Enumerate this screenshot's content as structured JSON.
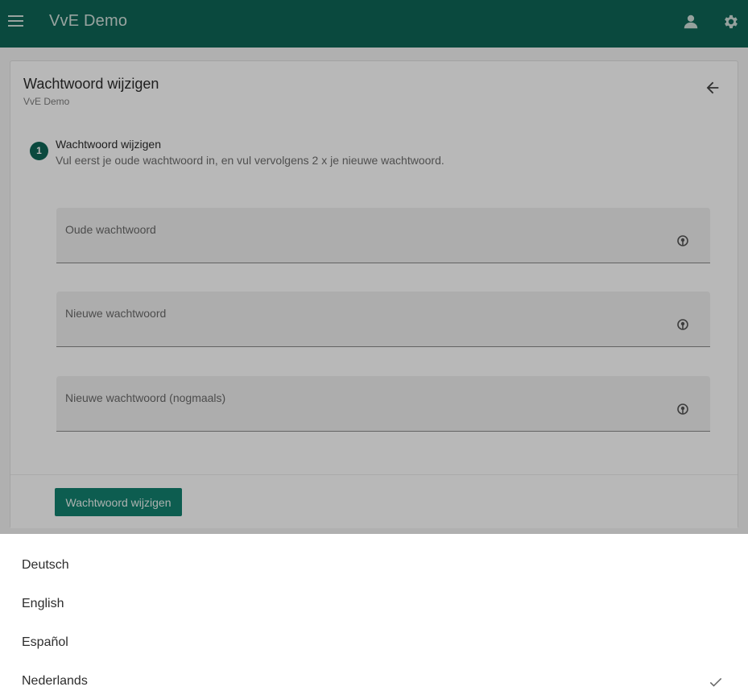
{
  "appbar": {
    "title": "VvE Demo",
    "menu_icon": "menu-icon",
    "account_icon": "account-icon",
    "settings_icon": "gear-icon",
    "color": "#0e6656"
  },
  "card": {
    "title": "Wachtwoord wijzigen",
    "subtitle": "VvE Demo",
    "back_icon": "arrow-left-icon"
  },
  "step": {
    "number": "1",
    "title": "Wachtwoord wijzigen",
    "description": "Vul eerst je oude wachtwoord in, en vul vervolgens 2 x je nieuwe wachtwoord."
  },
  "fields": [
    {
      "label": "Oude wachtwoord",
      "value": "",
      "icon": "visibility-icon"
    },
    {
      "label": "Nieuwe wachtwoord",
      "value": "",
      "icon": "visibility-icon"
    },
    {
      "label": "Nieuwe wachtwoord (nogmaals)",
      "value": "",
      "icon": "visibility-icon"
    }
  ],
  "actions": {
    "submit_label": "Wachtwoord wijzigen",
    "accent": "#13826f"
  },
  "language_sheet": {
    "options": [
      "Deutsch",
      "English",
      "Español",
      "Nederlands"
    ],
    "selected": "Nederlands",
    "check_icon": "check-icon"
  }
}
